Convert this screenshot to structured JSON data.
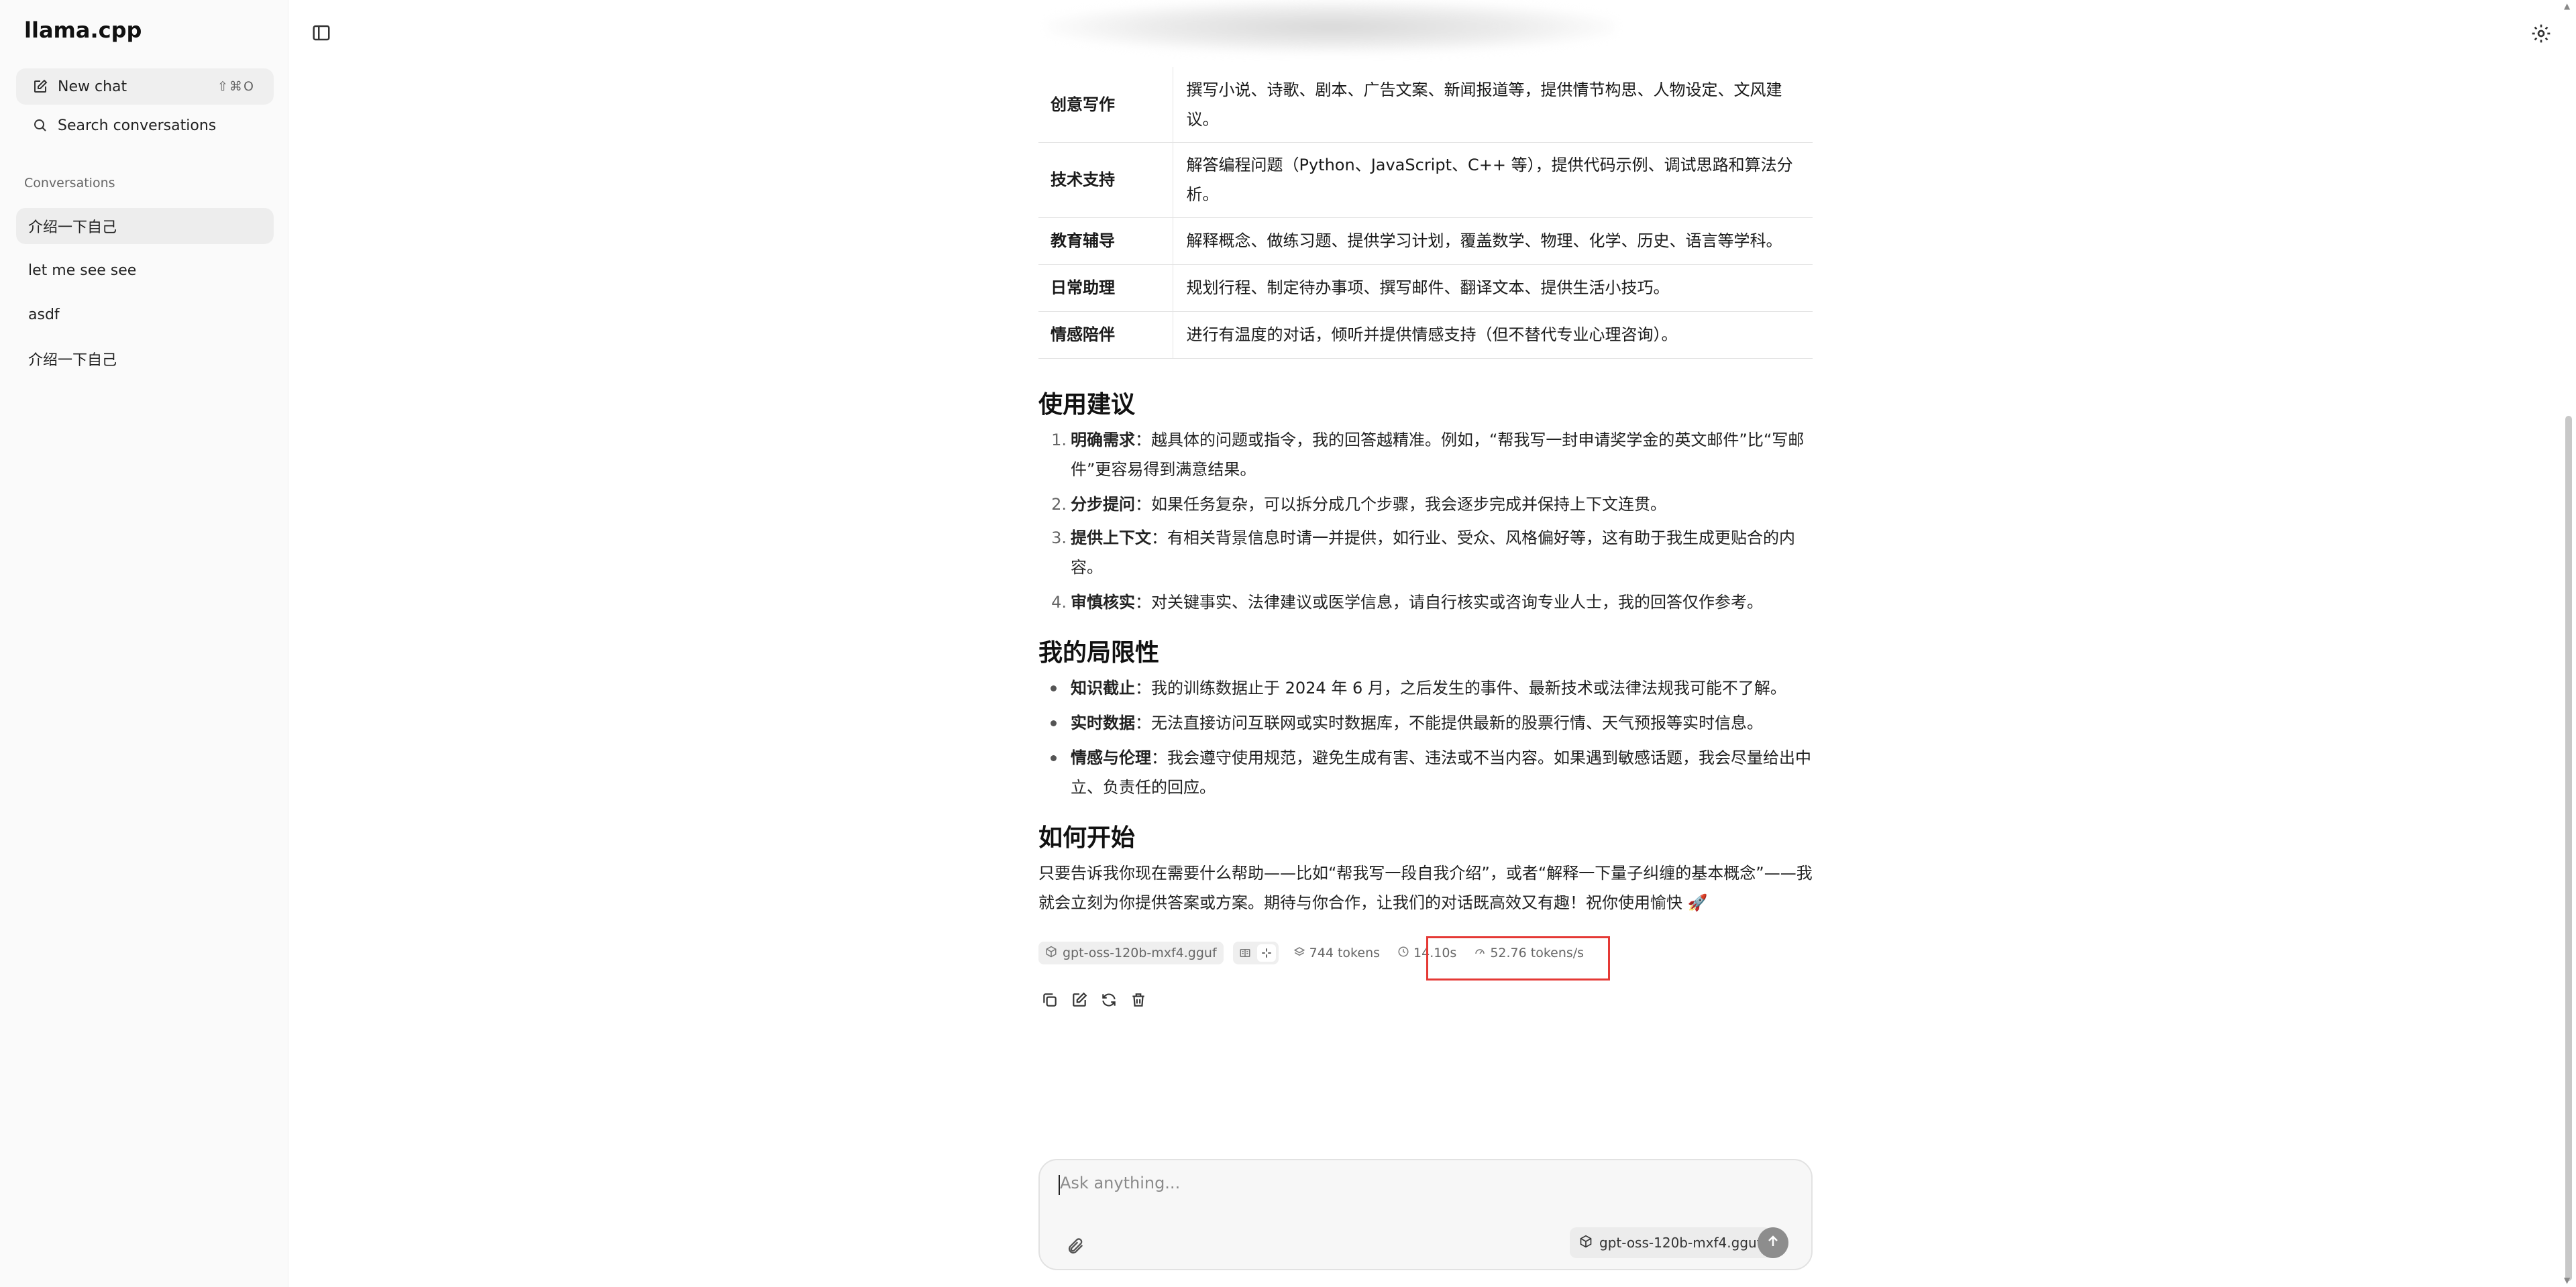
{
  "sidebar": {
    "brand": "llama.cpp",
    "new_chat": "New chat",
    "new_chat_shortcut": "⇧⌘O",
    "search": "Search conversations",
    "conversations_heading": "Conversations",
    "conversations": [
      "介绍一下自己",
      "let me see see",
      "asdf",
      "介绍一下自己"
    ]
  },
  "table": {
    "rows": [
      {
        "key": "创意写作",
        "value": "撰写小说、诗歌、剧本、广告文案、新闻报道等，提供情节构思、人物设定、文风建议。"
      },
      {
        "key": "技术支持",
        "value": "解答编程问题（Python、JavaScript、C++ 等），提供代码示例、调试思路和算法分析。"
      },
      {
        "key": "教育辅导",
        "value": "解释概念、做练习题、提供学习计划，覆盖数学、物理、化学、历史、语言等学科。"
      },
      {
        "key": "日常助理",
        "value": "规划行程、制定待办事项、撰写邮件、翻译文本、提供生活小技巧。"
      },
      {
        "key": "情感陪伴",
        "value": "进行有温度的对话，倾听并提供情感支持（但不替代专业心理咨询）。"
      }
    ]
  },
  "usage": {
    "heading": "使用建议",
    "items": [
      {
        "num": "1.",
        "title": "明确需求",
        "text": "：越具体的问题或指令，我的回答越精准。例如，“帮我写一封申请奖学金的英文邮件”比“写邮件”更容易得到满意结果。"
      },
      {
        "num": "2.",
        "title": "分步提问",
        "text": "：如果任务复杂，可以拆分成几个步骤，我会逐步完成并保持上下文连贯。"
      },
      {
        "num": "3.",
        "title": "提供上下文",
        "text": "：有相关背景信息时请一并提供，如行业、受众、风格偏好等，这有助于我生成更贴合的内容。"
      },
      {
        "num": "4.",
        "title": "审慎核实",
        "text": "：对关键事实、法律建议或医学信息，请自行核实或咨询专业人士，我的回答仅作参考。"
      }
    ]
  },
  "limits": {
    "heading": "我的局限性",
    "items": [
      {
        "title": "知识截止",
        "text": "：我的训练数据止于 2024 年 6 月，之后发生的事件、最新技术或法律法规我可能不了解。"
      },
      {
        "title": "实时数据",
        "text": "：无法直接访问互联网或实时数据库，不能提供最新的股票行情、天气预报等实时信息。"
      },
      {
        "title": "情感与伦理",
        "text": "：我会遵守使用规范，避免生成有害、违法或不当内容。如果遇到敏感话题，我会尽量给出中立、负责任的回应。"
      }
    ]
  },
  "start": {
    "heading": "如何开始",
    "text": "只要告诉我你现在需要什么帮助——比如“帮我写一段自我介绍”，或者“解释一下量子纠缠的基本概念”——我就会立刻为你提供答案或方案。期待与你合作，让我们的对话既高效又有趣！祝你使用愉快 🚀"
  },
  "stats": {
    "model": "gpt-oss-120b-mxf4.gguf",
    "tokens": "744 tokens",
    "time": "14.10s",
    "speed": "52.76 tokens/s"
  },
  "composer": {
    "placeholder": "Ask anything...",
    "model": "gpt-oss-120b-mxf4.gguf"
  },
  "colors": {
    "highlight": "#e53935",
    "sidebar_bg": "#fafafa",
    "send_button": "#8d8d8d"
  }
}
